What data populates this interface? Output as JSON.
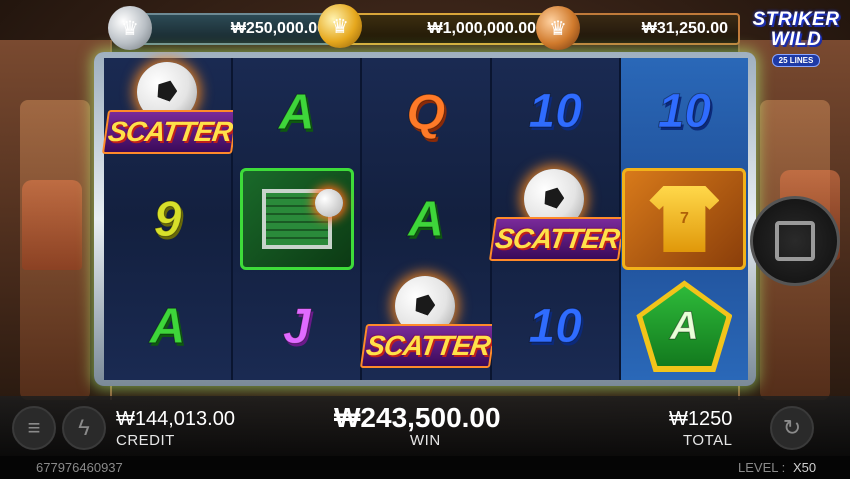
{
  "jackpots": {
    "major": "₩250,000.00",
    "grand": "₩1,000,000.00",
    "minor": "₩31,250.00"
  },
  "logo": {
    "line1": "STRIKER",
    "line2": "WILD",
    "lines": "25 LINES"
  },
  "reels": [
    [
      "SCATTER",
      "9",
      "A"
    ],
    [
      "A",
      "goal",
      "J"
    ],
    [
      "Q",
      "A",
      "SCATTER"
    ],
    [
      "10",
      "SCATTER",
      "10"
    ],
    [
      "10",
      "jersey",
      "A"
    ]
  ],
  "symbols": {
    "scatter_label": "SCATTER"
  },
  "bottom": {
    "credit_value": "₩144,013.00",
    "credit_label": "CREDIT",
    "win_value": "₩243,500.00",
    "win_label": "WIN",
    "total_value": "₩1250",
    "total_label": "TOTAL"
  },
  "footer": {
    "id": "677976460937",
    "level_label": "LEVEL : ",
    "level_value": "X50"
  },
  "colors": {
    "accent_green": "#3ed63a",
    "highlight_reel": "#2a68b8",
    "gold": "#d9a63a"
  }
}
